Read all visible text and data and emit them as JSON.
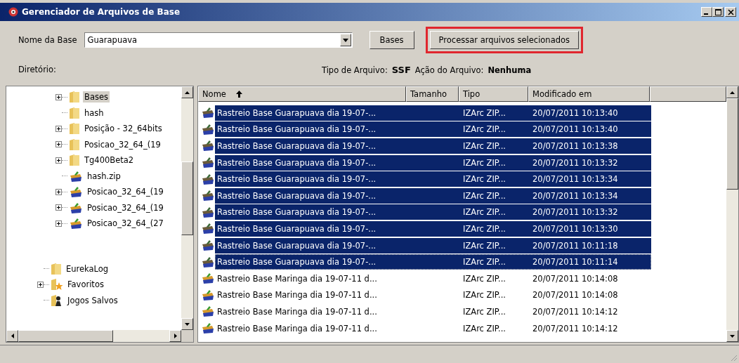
{
  "window": {
    "title": "Gerenciador de Arquivos de Base"
  },
  "toolbar": {
    "base_label": "Nome da Base",
    "base_value": "Guarapuava",
    "bases_button": "Bases",
    "process_button": "Processar arquivos selecionados",
    "process_highlighted": true,
    "directory_label": "Diretório:",
    "file_type_label": "Tipo de Arquivo:",
    "file_type_value": "SSF",
    "file_action_label": "Ação do Arquivo:",
    "file_action_value": "Nenhuma"
  },
  "tree": {
    "items": [
      {
        "kind": "hidden",
        "children": [
          {
            "label": "Bases",
            "kind": "folder",
            "expandable": true,
            "selected": true
          },
          {
            "label": "hash",
            "kind": "folder",
            "expandable": false,
            "selected": false
          },
          {
            "label": "Posição - 32_64bits",
            "kind": "folder",
            "expandable": true,
            "selected": false
          },
          {
            "label": "Posicao_32_64_(19",
            "kind": "folder",
            "expandable": true,
            "selected": false
          },
          {
            "label": "Tg400Beta2",
            "kind": "folder",
            "expandable": true,
            "selected": false
          },
          {
            "label": "hash.zip",
            "kind": "zip",
            "expandable": false,
            "selected": false
          },
          {
            "label": "Posicao_32_64_(19",
            "kind": "zip",
            "expandable": true,
            "selected": false
          },
          {
            "label": "Posicao_32_64_(19",
            "kind": "zip",
            "expandable": true,
            "selected": false
          },
          {
            "label": "Posicao_32_64_(27",
            "kind": "zip",
            "expandable": true,
            "selected": false
          }
        ]
      },
      {
        "label": "EurekaLog",
        "kind": "folder",
        "expandable": false,
        "selected": false
      },
      {
        "label": "Favoritos",
        "kind": "favorites",
        "expandable": true,
        "selected": false
      },
      {
        "label": "Jogos Salvos",
        "kind": "games",
        "expandable": false,
        "selected": false
      }
    ]
  },
  "table": {
    "columns": [
      {
        "label": "Nome",
        "sorted": true
      },
      {
        "label": "Tamanho",
        "sorted": false
      },
      {
        "label": "Tipo",
        "sorted": false
      },
      {
        "label": "Modificado em",
        "sorted": false
      }
    ],
    "rows": [
      {
        "name": "Rastreio Base Guarapuava dia 19-07-...",
        "type": "IZArc ZIP...",
        "modified": "20/07/2011 10:13:40",
        "selected": true,
        "focused": false
      },
      {
        "name": "Rastreio Base Guarapuava dia 19-07-...",
        "type": "IZArc ZIP...",
        "modified": "20/07/2011 10:13:40",
        "selected": true,
        "focused": false
      },
      {
        "name": "Rastreio Base Guarapuava dia 19-07-...",
        "type": "IZArc ZIP...",
        "modified": "20/07/2011 10:13:38",
        "selected": true,
        "focused": false
      },
      {
        "name": "Rastreio Base Guarapuava dia 19-07-...",
        "type": "IZArc ZIP...",
        "modified": "20/07/2011 10:13:32",
        "selected": true,
        "focused": false
      },
      {
        "name": "Rastreio Base Guarapuava dia 19-07-...",
        "type": "IZArc ZIP...",
        "modified": "20/07/2011 10:13:34",
        "selected": true,
        "focused": false
      },
      {
        "name": "Rastreio Base Guarapuava dia 19-07-...",
        "type": "IZArc ZIP...",
        "modified": "20/07/2011 10:13:34",
        "selected": true,
        "focused": false
      },
      {
        "name": "Rastreio Base Guarapuava dia 19-07-...",
        "type": "IZArc ZIP...",
        "modified": "20/07/2011 10:13:32",
        "selected": true,
        "focused": false
      },
      {
        "name": "Rastreio Base Guarapuava dia 19-07-...",
        "type": "IZArc ZIP...",
        "modified": "20/07/2011 10:13:30",
        "selected": true,
        "focused": false
      },
      {
        "name": "Rastreio Base Guarapuava dia 19-07-...",
        "type": "IZArc ZIP...",
        "modified": "20/07/2011 10:11:18",
        "selected": true,
        "focused": false
      },
      {
        "name": "Rastreio Base Guarapuava dia 19-07-...",
        "type": "IZArc ZIP...",
        "modified": "20/07/2011 10:11:14",
        "selected": true,
        "focused": true
      },
      {
        "name": "Rastreio Base Maringa dia 19-07-11 d...",
        "type": "IZArc ZIP...",
        "modified": "20/07/2011 10:14:08",
        "selected": false,
        "focused": false
      },
      {
        "name": "Rastreio Base Maringa dia 19-07-11 d...",
        "type": "IZArc ZIP...",
        "modified": "20/07/2011 10:14:08",
        "selected": false,
        "focused": false
      },
      {
        "name": "Rastreio Base Maringa dia 19-07-11 d...",
        "type": "IZArc ZIP...",
        "modified": "20/07/2011 10:14:12",
        "selected": false,
        "focused": false
      },
      {
        "name": "Rastreio Base Maringa dia 19-07-11 d...",
        "type": "IZArc ZIP...",
        "modified": "20/07/2011 10:14:12",
        "selected": false,
        "focused": false
      }
    ]
  }
}
